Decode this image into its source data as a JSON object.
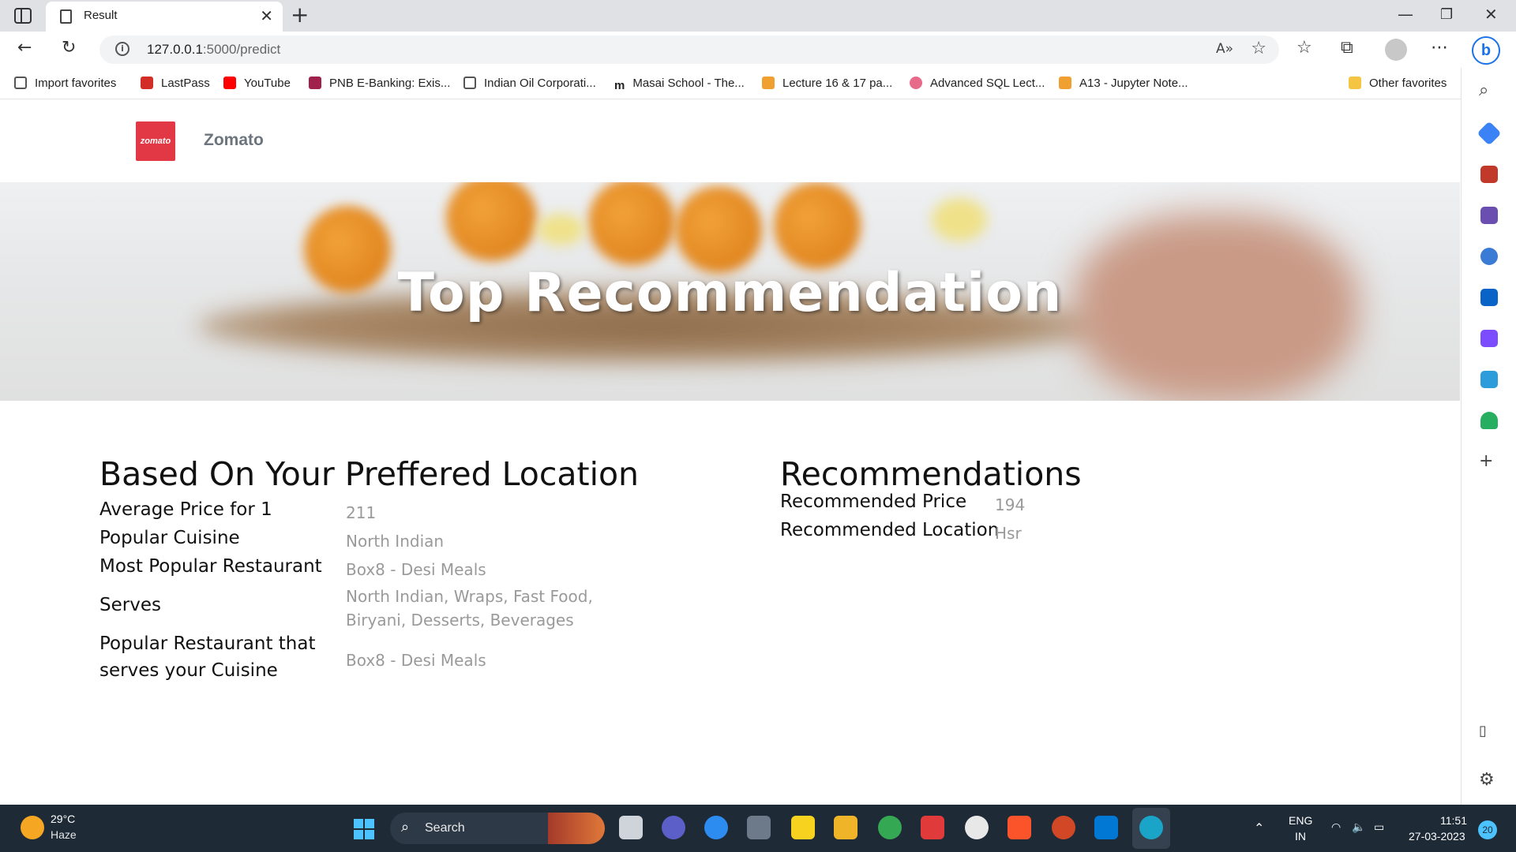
{
  "browser": {
    "tab_title": "Result",
    "url_host": "127.0.0.1",
    "url_path": ":5000/predict",
    "favorites": [
      {
        "label": "Import favorites",
        "color": "#555555"
      },
      {
        "label": "LastPass",
        "color": "#d32d27"
      },
      {
        "label": "YouTube",
        "color": "#ff0000"
      },
      {
        "label": "PNB E-Banking: Exis...",
        "color": "#a0214b"
      },
      {
        "label": "Indian Oil Corporati...",
        "color": "#555555"
      },
      {
        "label": "Masai School - The...",
        "color": "#222222"
      },
      {
        "label": "Lecture 16 & 17 pa...",
        "color": "#f0a030"
      },
      {
        "label": "Advanced SQL Lect...",
        "color": "#e86a8a"
      },
      {
        "label": "A13 - Jupyter Note...",
        "color": "#f0a030"
      }
    ],
    "other_favorites": "Other favorites"
  },
  "site": {
    "logo_text": "zomato",
    "brand": "Zomato",
    "hero_title": "Top Recommendation"
  },
  "left": {
    "title": "Based On Your Preffered Location",
    "rows": [
      {
        "label": "Average Price for 1",
        "value": "211"
      },
      {
        "label": "Popular Cuisine",
        "value": "North Indian"
      },
      {
        "label": "Most Popular Restaurant",
        "value": "Box8 - Desi Meals"
      },
      {
        "label": "Serves",
        "value_line1": "North Indian, Wraps, Fast Food,",
        "value_line2": "Biryani, Desserts, Beverages"
      },
      {
        "label_line1": "Popular Restaurant that",
        "label_line2": "serves your Cuisine",
        "value": "Box8 - Desi Meals"
      }
    ]
  },
  "right": {
    "title": "Recommendations",
    "rows": [
      {
        "label": "Recommended Price",
        "value": "194"
      },
      {
        "label": "Recommended Location",
        "value": "Hsr"
      }
    ]
  },
  "taskbar": {
    "temp": "29°C",
    "weather": "Haze",
    "search": "Search",
    "lang1": "ENG",
    "lang2": "IN",
    "time": "11:51",
    "date": "27-03-2023",
    "notifications": "20"
  }
}
